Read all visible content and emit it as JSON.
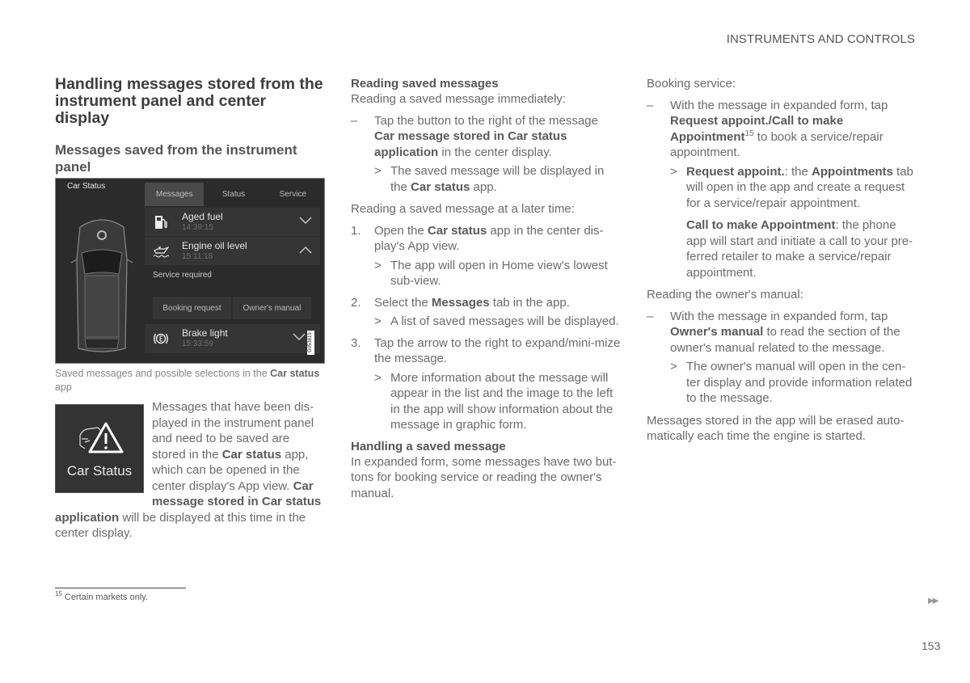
{
  "header": {
    "section": "INSTRUMENTS AND CONTROLS"
  },
  "col1": {
    "title": "Handling messages stored from the instrument panel and center display",
    "subtitle": "Messages saved from the instrument panel",
    "screenshot": {
      "app_title": "Car Status",
      "tabs": [
        {
          "label": "Messages",
          "active": true
        },
        {
          "label": "Status",
          "active": false
        },
        {
          "label": "Service",
          "active": false
        }
      ],
      "messages": [
        {
          "title": "Aged fuel",
          "time": "14:39:15",
          "icon": "fuel-pump-icon",
          "expanded": false
        },
        {
          "title": "Engine oil level",
          "time": "15:11:18",
          "icon": "oil-can-icon",
          "expanded": true
        },
        {
          "title": "Brake light",
          "time": "15:33:59",
          "icon": "brake-warning-icon",
          "expanded": false
        }
      ],
      "detail_text": "Service required",
      "buttons": [
        "Booking request",
        "Owner's manual"
      ],
      "image_code": "G053819"
    },
    "caption": {
      "pre": "Saved messages and possible selections in the ",
      "bold": "Car status",
      "post": " app"
    },
    "app_icon_label": "Car Status",
    "body": {
      "t1": "Messages that have been dis-played in the instrument panel and need to be saved are stored in the ",
      "b1": "Car status",
      "t2": " app, which can be opened in the center display's App view. ",
      "b2": "Car message stored in Car status application",
      "t3": " will be displayed at this time in the center display."
    }
  },
  "col2": {
    "h_reading": "Reading saved messages",
    "reading_immediately": "Reading a saved message immediately:",
    "step_dash": {
      "marker": "–",
      "t1": "Tap the button to the right of the message ",
      "b1": "Car message stored in Car status application",
      "t2": " in the center display."
    },
    "result_1": {
      "marker": ">",
      "t1": "The saved message will be displayed in the ",
      "b1": "Car status",
      "t2": " app."
    },
    "reading_later": "Reading a saved message at a later time:",
    "steps": [
      {
        "marker": "1.",
        "t1": "Open the ",
        "b1": "Car status",
        "t2": " app in the center dis-play's App view.",
        "result": "The app will open in Home view's lowest sub-view."
      },
      {
        "marker": "2.",
        "t1": "Select the ",
        "b1": "Messages",
        "t2": " tab in the app.",
        "result": "A list of saved messages will be displayed."
      },
      {
        "marker": "3.",
        "t1": "Tap the arrow to the right to expand/mini-mize the message.",
        "b1": "",
        "t2": "",
        "result": "More information about the message will appear in the list and the image to the left in the app will show information about the message in graphic form."
      }
    ],
    "h_handling": "Handling a saved message",
    "handling_text": "In expanded form, some messages have two but-tons for booking service or reading the owner's manual."
  },
  "col3": {
    "booking_intro": "Booking service:",
    "booking_step": {
      "marker": "–",
      "t1": "With the message in expanded form, tap ",
      "b1": "Request appoint./Call to make Appointment",
      "sup": "15",
      "t2": " to book a service/repair appointment."
    },
    "booking_result_1": {
      "marker": ">",
      "b1": "Request appoint.",
      "t1": ": the ",
      "b2": "Appointments",
      "t2": " tab will open in the app and create a request for a service/repair appointment."
    },
    "booking_result_2": {
      "b1": "Call to make Appointment",
      "t1": ": the phone app will start and initiate a call to your pre-ferred retailer to make a service/repair appointment."
    },
    "manual_intro": "Reading the owner's manual:",
    "manual_step": {
      "marker": "–",
      "t1": "With the message in expanded form, tap ",
      "b1": "Owner's manual",
      "t2": " to read the section of the owner's manual related to the message."
    },
    "manual_result": {
      "marker": ">",
      "t1": "The owner's manual will open in the cen-ter display and provide information related to the message."
    },
    "closing": "Messages stored in the app will be erased auto-matically each time the engine is started."
  },
  "footnote": {
    "number": "15",
    "text": "Certain markets only."
  },
  "continue_marker": "▶▶",
  "page_number": "153"
}
